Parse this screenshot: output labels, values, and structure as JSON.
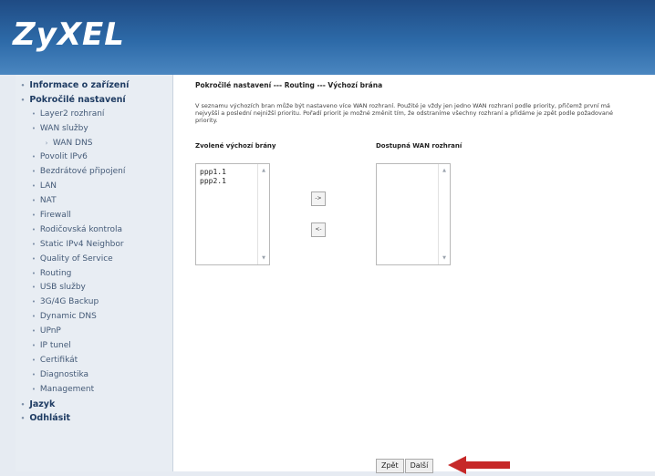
{
  "brand": {
    "logo_text": "ZyXEL"
  },
  "sidebar": {
    "items": [
      {
        "label": "Informace o zařízení",
        "level": 0
      },
      {
        "label": "Pokročilé nastavení",
        "level": 0
      },
      {
        "label": "Layer2 rozhraní",
        "level": 1
      },
      {
        "label": "WAN služby",
        "level": 1
      },
      {
        "label": "WAN DNS",
        "level": 2
      },
      {
        "label": "Povolit IPv6",
        "level": 1
      },
      {
        "label": "Bezdrátové připojení",
        "level": 1
      },
      {
        "label": "LAN",
        "level": 1
      },
      {
        "label": "NAT",
        "level": 1
      },
      {
        "label": "Firewall",
        "level": 1
      },
      {
        "label": "Rodičovská kontrola",
        "level": 1
      },
      {
        "label": "Static IPv4 Neighbor",
        "level": 1
      },
      {
        "label": "Quality of Service",
        "level": 1
      },
      {
        "label": "Routing",
        "level": 1
      },
      {
        "label": "USB služby",
        "level": 1
      },
      {
        "label": "3G/4G Backup",
        "level": 1
      },
      {
        "label": "Dynamic DNS",
        "level": 1
      },
      {
        "label": "UPnP",
        "level": 1
      },
      {
        "label": "IP tunel",
        "level": 1
      },
      {
        "label": "Certifikát",
        "level": 1
      },
      {
        "label": "Diagnostika",
        "level": 1
      },
      {
        "label": "Management",
        "level": 1
      },
      {
        "label": "Jazyk",
        "level": 0
      },
      {
        "label": "Odhlásit",
        "level": 0
      }
    ]
  },
  "main": {
    "breadcrumb": "Pokročilé nastavení --- Routing --- Výchozí brána",
    "description": "V seznamu výchozích bran může být nastaveno více WAN rozhraní. Použité je vždy jen jedno WAN rozhraní podle priority, přičemž první má nejvyšší a poslední nejnižší prioritu. Pořadí priorit je možné změnit tím, že odstraníme všechny rozhraní a přidáme je zpět podle požadované priority.",
    "left_column_title": "Zvolené výchozí brány",
    "right_column_title": "Dostupná WAN rozhraní",
    "selected_gateways": [
      "ppp1.1",
      "ppp2.1"
    ],
    "available_interfaces": [],
    "move_right_label": "->",
    "move_left_label": "<-",
    "back_label": "Zpět",
    "next_label": "Další"
  },
  "colors": {
    "header_bg": "#2d6aa8",
    "sidebar_bg": "#e8edf3",
    "arrow": "#c62828"
  },
  "icons": {
    "bullet": "•",
    "annotation": "red-arrow-icon"
  }
}
